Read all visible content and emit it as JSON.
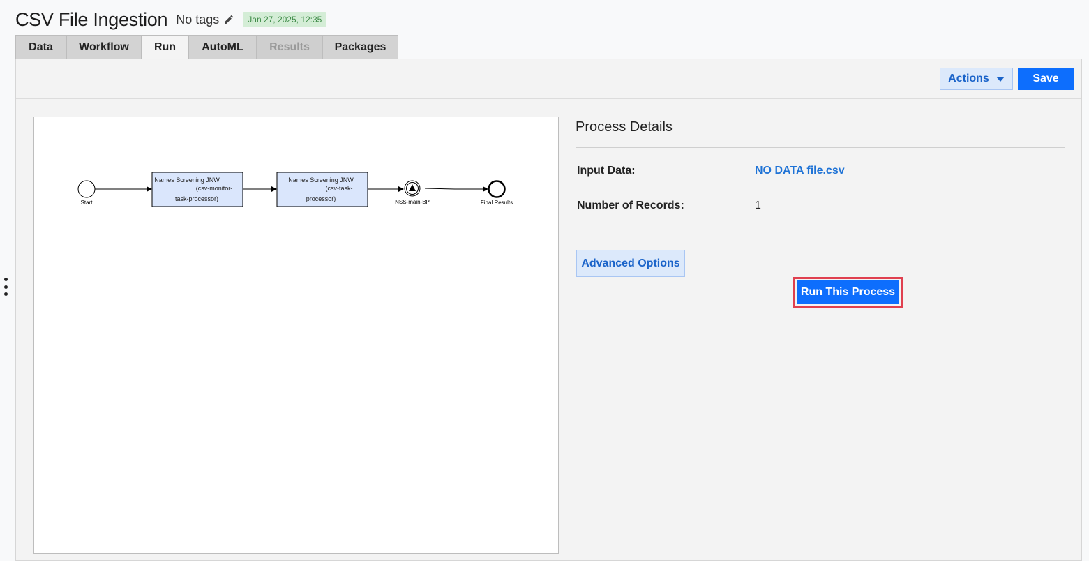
{
  "header": {
    "title": "CSV File Ingestion",
    "tags_label": "No tags",
    "date_badge": "Jan 27, 2025, 12:35"
  },
  "tabs": [
    {
      "label": "Data",
      "state": "normal"
    },
    {
      "label": "Workflow",
      "state": "normal"
    },
    {
      "label": "Run",
      "state": "active"
    },
    {
      "label": "AutoML",
      "state": "normal"
    },
    {
      "label": "Results",
      "state": "disabled"
    },
    {
      "label": "Packages",
      "state": "normal"
    }
  ],
  "toolbar": {
    "actions_label": "Actions",
    "save_label": "Save"
  },
  "diagram": {
    "start_label": "Start",
    "task1": {
      "line1": "Names Screening JNW",
      "line2": "(csv-monitor-",
      "line3": "task-processor)"
    },
    "task2": {
      "line1": "Names Screening JNW",
      "line2": "(csv-task-",
      "line3": "processor)"
    },
    "event_label": "NSS-main-BP",
    "end_label": "Final Results"
  },
  "details": {
    "title": "Process Details",
    "input_data_label": "Input Data:",
    "input_data_value": "NO DATA file.csv",
    "records_label": "Number of Records:",
    "records_value": "1",
    "advanced_label": "Advanced Options",
    "run_label": "Run This Process"
  },
  "colors": {
    "primary": "#0d6efd",
    "link": "#1f73d6",
    "task_fill": "#dae6fc",
    "highlight": "#e0404f",
    "badge_bg": "#d4edd6"
  }
}
